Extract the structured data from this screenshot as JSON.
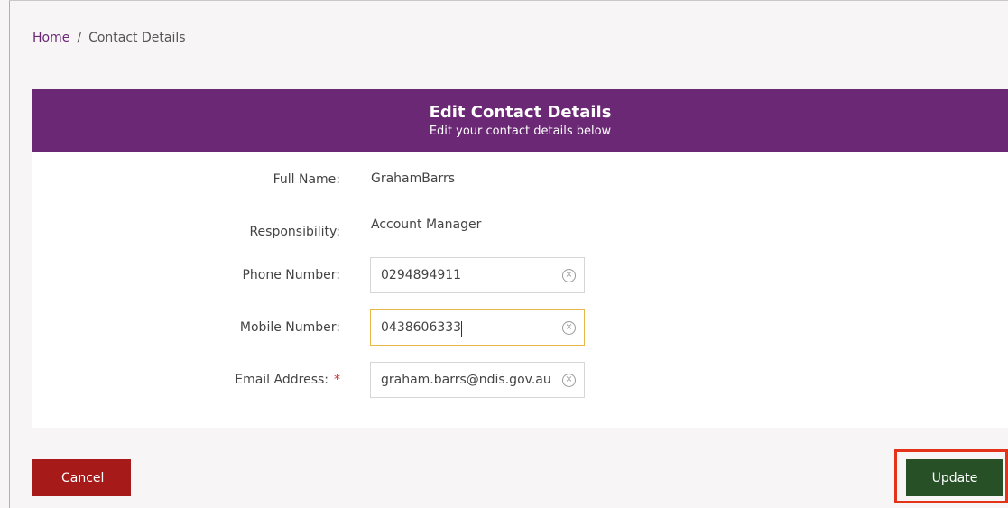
{
  "breadcrumb": {
    "home": "Home",
    "separator": "/",
    "current": "Contact Details"
  },
  "card": {
    "title": "Edit Contact Details",
    "subtitle": "Edit your contact details below"
  },
  "fields": {
    "full_name": {
      "label": "Full Name:",
      "value": "GrahamBarrs"
    },
    "responsibility": {
      "label": "Responsibility:",
      "value": "Account Manager"
    },
    "phone": {
      "label": "Phone Number:",
      "value": "0294894911"
    },
    "mobile": {
      "label": "Mobile Number:",
      "value": "0438606333"
    },
    "email": {
      "label": "Email Address:",
      "required_marker": "*",
      "value": "graham.barrs@ndis.gov.au"
    }
  },
  "buttons": {
    "cancel": "Cancel",
    "update": "Update"
  },
  "colors": {
    "header_purple": "#6b2874",
    "cancel_red": "#a71a1a",
    "update_green": "#275027",
    "focus_border": "#e8b74a",
    "highlight_red": "#e3341a",
    "required_red": "#d22d2d"
  },
  "icons": {
    "clear": "clear-icon",
    "clear_glyph": "×"
  }
}
